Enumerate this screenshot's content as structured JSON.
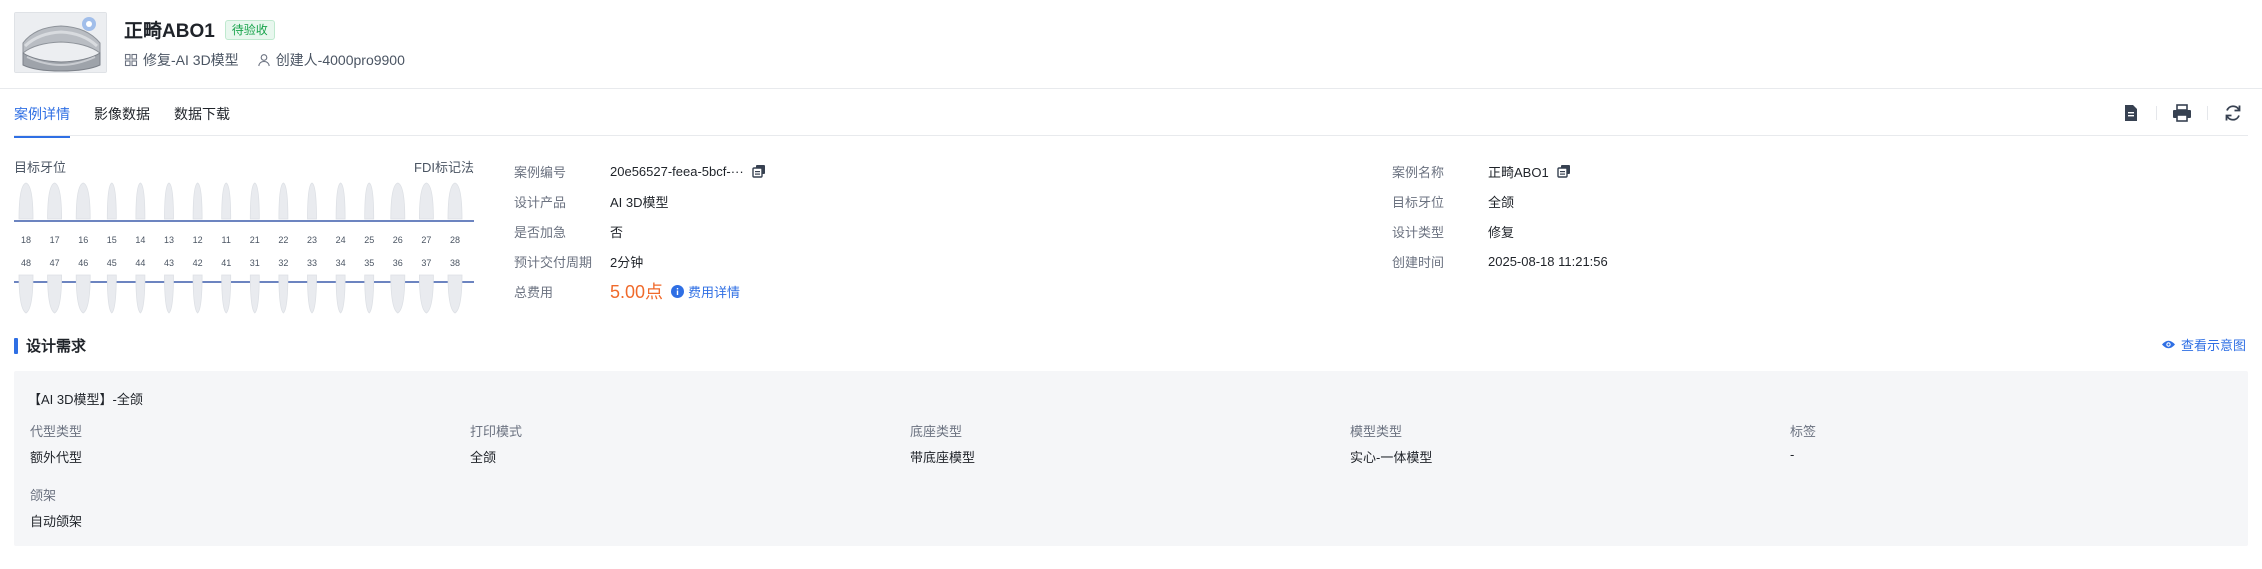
{
  "header": {
    "title": "正畸ABO1",
    "status_badge": "待验收",
    "type_text": "修复-AI 3D模型",
    "creator_text": "创建人-4000pro9900"
  },
  "tabs": [
    {
      "label": "案例详情",
      "active": true
    },
    {
      "label": "影像数据",
      "active": false
    },
    {
      "label": "数据下载",
      "active": false
    }
  ],
  "toolbar": {
    "icons": [
      "document-icon",
      "print-icon",
      "refresh-icon"
    ]
  },
  "tooth_chart": {
    "label": "目标牙位",
    "notation": "FDI标记法",
    "upper_numbers": [
      "18",
      "17",
      "16",
      "15",
      "14",
      "13",
      "12",
      "11",
      "21",
      "22",
      "23",
      "24",
      "25",
      "26",
      "27",
      "28"
    ],
    "lower_numbers": [
      "48",
      "47",
      "46",
      "45",
      "44",
      "43",
      "42",
      "41",
      "31",
      "32",
      "33",
      "34",
      "35",
      "36",
      "37",
      "38"
    ]
  },
  "info_left": {
    "case_no_label": "案例编号",
    "case_no_value": "20e56527-feea-5bcf-···",
    "product_label": "设计产品",
    "product_value": "AI 3D模型",
    "urgent_label": "是否加急",
    "urgent_value": "否",
    "delivery_label": "预计交付周期",
    "delivery_value": "2分钟",
    "fee_label": "总费用",
    "fee_value": "5.00点",
    "fee_link": "费用详情"
  },
  "info_right": {
    "name_label": "案例名称",
    "name_value": "正畸ABO1",
    "tooth_label": "目标牙位",
    "tooth_value": "全颌",
    "design_type_label": "设计类型",
    "design_type_value": "修复",
    "created_label": "创建时间",
    "created_value": "2025-08-18 11:21:56"
  },
  "requirements": {
    "section_title": "设计需求",
    "view_link": "查看示意图",
    "heading": "【AI 3D模型】-全颌",
    "items": [
      {
        "label": "代型类型",
        "value": "额外代型"
      },
      {
        "label": "打印模式",
        "value": "全颌"
      },
      {
        "label": "底座类型",
        "value": "带底座模型"
      },
      {
        "label": "模型类型",
        "value": "实心-一体模型"
      },
      {
        "label": "标签",
        "value": "-"
      },
      {
        "label": "颌架",
        "value": "自动颌架"
      }
    ]
  },
  "colors": {
    "accent": "#2f6fe4",
    "fee": "#f06a2b",
    "badge_text": "#16a34a",
    "badge_bg": "#e8f7ee"
  }
}
